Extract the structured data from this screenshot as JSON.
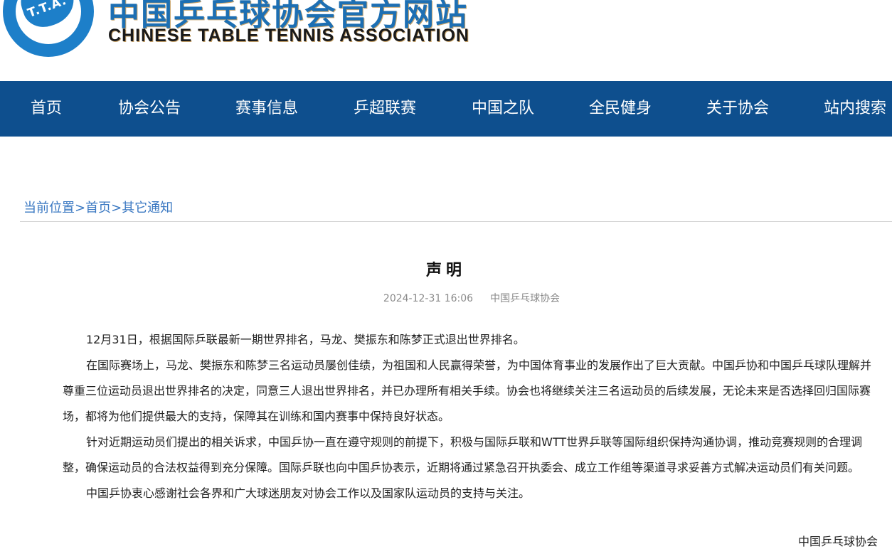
{
  "header": {
    "logo_text": "T.T.A.",
    "title_cn": "中国乒乓球协会官方网站",
    "title_en": "CHINESE TABLE TENNIS ASSOCIATION"
  },
  "nav": {
    "items": [
      "首页",
      "协会公告",
      "赛事信息",
      "乒超联赛",
      "中国之队",
      "全民健身",
      "关于协会",
      "站内搜索"
    ]
  },
  "breadcrumb": {
    "current": "当前位置",
    "home": "首页",
    "section": "其它通知",
    "separator": ">"
  },
  "article": {
    "title": "声明",
    "date": "2024-12-31 16:06",
    "source": "中国乒乓球协会",
    "paragraphs": [
      "12月31日，根据国际乒联最新一期世界排名，马龙、樊振东和陈梦正式退出世界排名。",
      "在国际赛场上，马龙、樊振东和陈梦三名运动员屡创佳绩，为祖国和人民赢得荣誉，为中国体育事业的发展作出了巨大贡献。中国乒协和中国乒乓球队理解并尊重三位运动员退出世界排名的决定，同意三人退出世界排名，并已办理所有相关手续。协会也将继续关注三名运动员的后续发展，无论未来是否选择回归国际赛场，都将为他们提供最大的支持，保障其在训练和国内赛事中保持良好状态。",
      "针对近期运动员们提出的相关诉求，中国乒协一直在遵守规则的前提下，积极与国际乒联和WTT世界乒联等国际组织保持沟通协调，推动竞赛规则的合理调整，确保运动员的合法权益得到充分保障。国际乒联也向中国乒协表示，近期将通过紧急召开执委会、成立工作组等渠道寻求妥善方式解决运动员们有关问题。",
      "中国乒协衷心感谢社会各界和广大球迷朋友对协会工作以及国家队运动员的支持与关注。"
    ],
    "signature": "中国乒乓球协会"
  }
}
